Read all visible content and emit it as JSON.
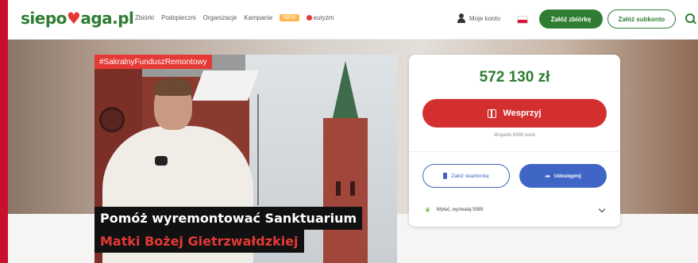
{
  "header": {
    "logo": {
      "part1": "siepo",
      "heart": "♥",
      "part2": "aga",
      "tld": ".pl"
    },
    "nav": [
      "Zbiórki",
      "Podopieczni",
      "Organizacje",
      "Kampanie"
    ],
    "nav_new_badge": "NEW",
    "nav_youtube": "eutyzm",
    "account_label": "Moje konto",
    "create_button": "Załóż zbiórkę",
    "subscribe_button": "Załóż subkonto",
    "icons": {
      "account": "user-icon",
      "search": "search-icon",
      "language": "flag-pl-icon"
    }
  },
  "hero": {
    "tag": "#SakralnyFunduszRemontowy",
    "title_line1": "Pomóż wyremontować Sanktuarium",
    "title_line2": "Matki Bożej Gietrzwałdzkiej"
  },
  "donation": {
    "amount": "572 130 zł",
    "support_button": "Wesprzyj",
    "supporters_text": "Wsparło 6390 osób",
    "collect_button": "Załóż skarbonkę",
    "share_button": "Udostępnij",
    "impact_text": "Wpłać, wyzwalaj 5985"
  },
  "colors": {
    "brand_green": "#2e7d32",
    "support_red": "#d32f2f",
    "action_blue": "#3f66c5",
    "side_bar_red": "#c8102e"
  }
}
